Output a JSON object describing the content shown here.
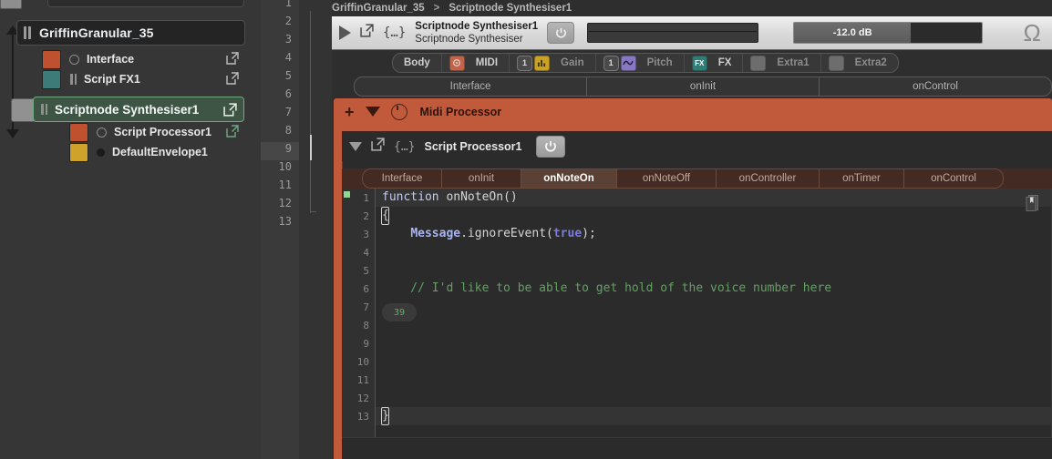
{
  "sidebar": {
    "project_title": "GriffinGranular_35",
    "items": [
      {
        "label": "Interface",
        "swatch": "#c0512f",
        "marker": "circle-outline",
        "indent": 1,
        "ext": true
      },
      {
        "label": "Script FX1",
        "swatch": "#3d7b78",
        "marker": "grip",
        "indent": 1,
        "ext": true
      },
      {
        "label": "Scriptnode Synthesiser1",
        "swatch": "#919191",
        "marker": "grip",
        "indent": 0,
        "ext": true,
        "selected": true
      },
      {
        "label": "Script Processor1",
        "swatch": "#c0512f",
        "marker": "circle-outline",
        "indent": 2,
        "ext": true
      },
      {
        "label": "DefaultEnvelope1",
        "swatch": "#cfa22b",
        "marker": "circle-filled",
        "indent": 2,
        "ext": false
      }
    ],
    "accent_selected": "#6ea880"
  },
  "line_strip": {
    "numbers": [
      "1",
      "2",
      "3",
      "4",
      "5",
      "6",
      "7",
      "8",
      "9",
      "10",
      "11",
      "12",
      "13"
    ],
    "highlighted": "9"
  },
  "main": {
    "breadcrumb": {
      "root": "GriffinGranular_35",
      "separator": ">",
      "current": "Scriptnode Synthesiser1"
    },
    "module_header": {
      "name": "Scriptnode Synthesiser1",
      "type": "Scriptnode Synthesiser",
      "play_icon": "play-icon",
      "popout_icon": "popout-icon",
      "script_icon": "curly-braces-icon",
      "power_icon": "power-icon",
      "gain_value": "-12.0 dB",
      "gain_fill_percent": 62,
      "preset_icon": "omega-icon"
    },
    "routing": [
      {
        "label": "Body",
        "badge": null,
        "dim": false
      },
      {
        "label": "MIDI",
        "badge": "midi-indicator",
        "badge_color": "#c0644b",
        "dim": false
      },
      {
        "label": "Gain",
        "badge": "channel-1",
        "badge2": "level-meter-icon",
        "badge2_color": "#c9a227",
        "dim": true
      },
      {
        "label": "Pitch",
        "badge": "channel-1",
        "badge2": "pitch-wave-icon",
        "badge2_color": "#8878c4",
        "dim": true
      },
      {
        "label": "FX",
        "badge": "fx-badge",
        "badge_color": "#2f7d74",
        "dim": false
      },
      {
        "label": "Extra1",
        "badge": "empty-slot",
        "badge_color": "#6d6d6d",
        "dim": true
      },
      {
        "label": "Extra2",
        "badge": "empty-slot",
        "badge_color": "#6d6d6d",
        "dim": true
      }
    ],
    "outer_tabs": [
      {
        "label": "Interface",
        "active": false
      },
      {
        "label": "onInit",
        "active": false
      },
      {
        "label": "onControl",
        "active": false
      }
    ],
    "midi_panel": {
      "title": "Midi Processor",
      "color": "#c05a3a",
      "add_icon": "plus-icon",
      "collapse_icon": "triangle-down-icon",
      "knob_icon": "knob-icon"
    },
    "script_processor": {
      "title": "Script Processor1",
      "collapse_icon": "triangle-down-icon",
      "popout_icon": "popout-icon",
      "script_icon": "curly-braces-icon",
      "power_icon": "power-icon",
      "tabs": [
        {
          "label": "Interface",
          "active": false
        },
        {
          "label": "onInit",
          "active": false
        },
        {
          "label": "onNoteOn",
          "active": true
        },
        {
          "label": "onNoteOff",
          "active": false
        },
        {
          "label": "onController",
          "active": false
        },
        {
          "label": "onTimer",
          "active": false
        },
        {
          "label": "onControl",
          "active": false
        }
      ],
      "doc_icon": "bookmark-document-icon"
    },
    "code": {
      "gutter": [
        "1",
        "2",
        "3",
        "4",
        "5",
        "6",
        "7",
        "8",
        "9",
        "10",
        "11",
        "12",
        "13"
      ],
      "highlight_lines": [
        1,
        13
      ],
      "inline_value_pill": "39",
      "lines": [
        {
          "n": 1,
          "tokens": [
            {
              "t": "function ",
              "c": "kw"
            },
            {
              "t": "onNoteOn()",
              "c": "fnname"
            }
          ]
        },
        {
          "n": 2,
          "tokens": [
            {
              "t": "{",
              "c": "punct"
            }
          ]
        },
        {
          "n": 3,
          "tokens": [
            {
              "t": "    ",
              "c": "punct"
            },
            {
              "t": "Message",
              "c": "obj"
            },
            {
              "t": ".ignoreEvent(",
              "c": "meth"
            },
            {
              "t": "true",
              "c": "bool"
            },
            {
              "t": ");",
              "c": "meth"
            }
          ]
        },
        {
          "n": 4,
          "tokens": []
        },
        {
          "n": 5,
          "tokens": []
        },
        {
          "n": 6,
          "tokens": [
            {
              "t": "    // I'd like to be able to get hold of the voice number here",
              "c": "cmt"
            }
          ]
        },
        {
          "n": 7,
          "tokens": []
        },
        {
          "n": 8,
          "tokens": []
        },
        {
          "n": 9,
          "tokens": []
        },
        {
          "n": 10,
          "tokens": []
        },
        {
          "n": 11,
          "tokens": []
        },
        {
          "n": 12,
          "tokens": []
        },
        {
          "n": 13,
          "tokens": [
            {
              "t": "}",
              "c": "punct"
            }
          ]
        }
      ]
    }
  }
}
